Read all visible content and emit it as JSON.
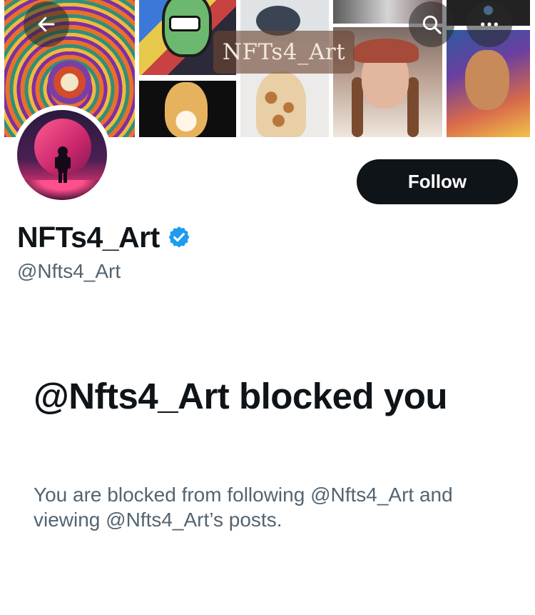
{
  "header": {
    "banner_label": "NFTs4_Art",
    "back_icon": "arrow-left-icon",
    "search_icon": "search-icon",
    "more_icon": "more-horizontal-icon"
  },
  "profile": {
    "display_name": "NFTs4_Art",
    "handle": "@Nfts4_Art",
    "verified_color": "#1d9bf0",
    "follow_label": "Follow"
  },
  "blocked": {
    "title": "@Nfts4_Art blocked you",
    "description": "You are blocked from following @Nfts4_Art and viewing @Nfts4_Art’s posts."
  },
  "colors": {
    "text_primary": "#0f1419",
    "text_secondary": "#536471",
    "button_bg": "#0f1419",
    "button_text": "#ffffff"
  }
}
